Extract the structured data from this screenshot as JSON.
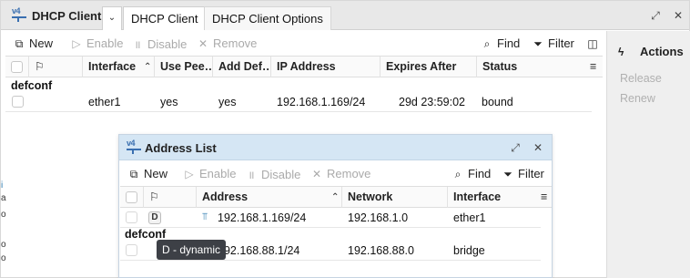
{
  "main_window": {
    "title": "DHCP Client",
    "tab_dropdown_icon": "chevron-down-icon",
    "tabs": [
      {
        "label": "DHCP Client",
        "active": true
      },
      {
        "label": "DHCP Client Options",
        "active": false
      }
    ],
    "toolbar": {
      "new": "New",
      "enable": "Enable",
      "disable": "Disable",
      "remove": "Remove",
      "find": "Find",
      "filter": "Filter"
    },
    "columns": [
      "Interface",
      "Use Pee…",
      "Add Def…",
      "IP Address",
      "Expires After",
      "Status"
    ],
    "groups": [
      {
        "label": "defconf",
        "rows": [
          {
            "interface": "ether1",
            "use_peer": "yes",
            "add_default": "yes",
            "ip_address": "192.168.1.169/24",
            "expires_after": "29d 23:59:02",
            "status": "bound"
          }
        ]
      }
    ]
  },
  "actions_panel": {
    "title": "Actions",
    "items": [
      "Release",
      "Renew"
    ]
  },
  "stray_glyphs": [
    "i",
    "a",
    "o",
    "o",
    "o"
  ],
  "child_window": {
    "title": "Address List",
    "toolbar": {
      "new": "New",
      "enable": "Enable",
      "disable": "Disable",
      "remove": "Remove",
      "find": "Find",
      "filter": "Filter"
    },
    "columns": [
      "Address",
      "Network",
      "Interface"
    ],
    "rows": [
      {
        "flag": "D",
        "address": "192.168.1.169/24",
        "network": "192.168.1.0",
        "interface": "ether1"
      }
    ],
    "groups": [
      {
        "label": "defconf",
        "rows": [
          {
            "address": "192.168.88.1/24",
            "network": "192.168.88.0",
            "interface": "bridge"
          }
        ]
      }
    ],
    "tooltip": "D - dynamic"
  },
  "colors": {
    "accent": "#3a6fb0",
    "child_titlebar": "#d5e6f4",
    "tooltip_bg": "#3d4046"
  }
}
